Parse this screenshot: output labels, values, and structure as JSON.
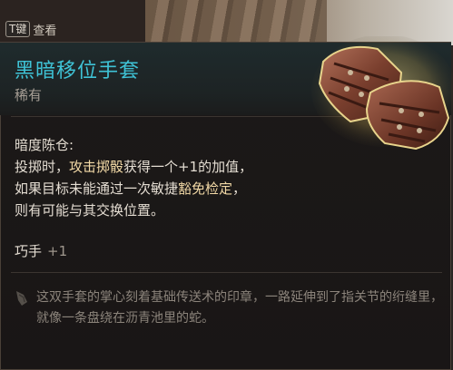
{
  "keyhint": {
    "key": "T键",
    "label": "查看"
  },
  "item": {
    "name": "黑暗移位手套",
    "rarity": "稀有",
    "ability_name": "暗度陈仓:",
    "desc_line1_pre": "投掷时，",
    "desc_line1_hl": "攻击掷骰",
    "desc_line1_post": "获得一个+1的加值，",
    "desc_line2_pre": "如果目标未能通过一次敏捷",
    "desc_line2_hl": "豁免检定",
    "desc_line2_post": "，",
    "desc_line3": "则有可能与其交换位置。",
    "proficiency": "巧手",
    "proficiency_bonus": "+1",
    "flavor": "这双手套的掌心刻着基础传送术的印章，一路延伸到了指关节的绗缝里，就像一条盘绕在沥青池里的蛇。"
  },
  "colors": {
    "title": "#3fc3d6",
    "highlight": "#f2d9a6",
    "text": "#e4ddd2",
    "muted": "#8c847b"
  },
  "icons": {
    "item_image": "leather-gloves-icon",
    "flavor_marker": "quote-icon"
  }
}
